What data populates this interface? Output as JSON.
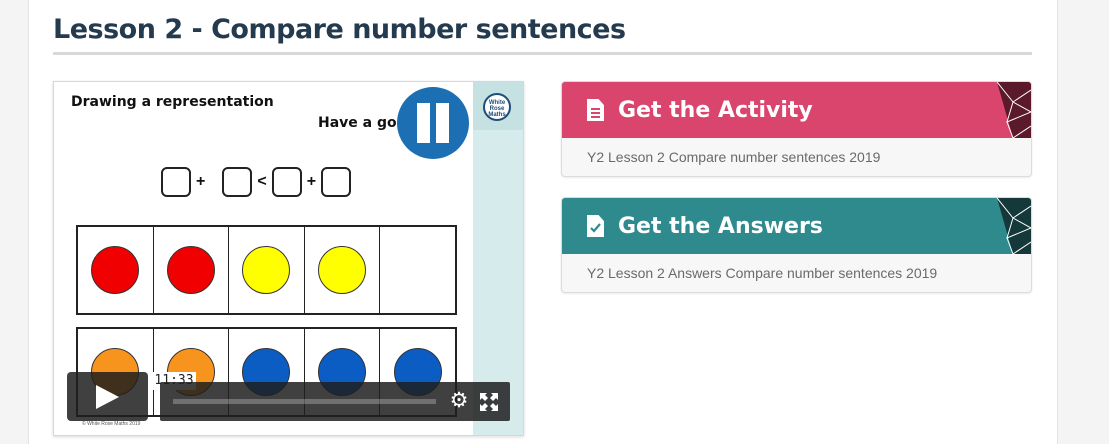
{
  "lesson": {
    "title": "Lesson 2 - Compare number sentences"
  },
  "video": {
    "slide_heading": "Drawing a representation",
    "slide_prompt": "Have a go",
    "logo_text": "White Rose Maths",
    "footer_text": "© White Rose Maths 2019",
    "equation_ops": [
      "+",
      "<",
      "+"
    ],
    "row1_colors": [
      "#f00000",
      "#f00000",
      "#ffff00",
      "#ffff00",
      ""
    ],
    "row2_colors": [
      "#f7941d",
      "#f7941d",
      "#0b5dc4",
      "#0b5dc4",
      "#0b5dc4"
    ],
    "time_tooltip": "11:33",
    "play_icon": "play-icon",
    "settings_icon": "gear-icon",
    "fullscreen_icon": "fullscreen-icon"
  },
  "activity_card": {
    "heading": "Get the Activity",
    "link_text": "Y2 Lesson 2 Compare number sentences 2019",
    "color": "#d9456c",
    "corner_color": "#5a1a2b"
  },
  "answers_card": {
    "heading": "Get the Answers",
    "link_text": "Y2 Lesson 2 Answers Compare number sentences 2019",
    "color": "#2e8a8c",
    "corner_color": "#15393a"
  }
}
